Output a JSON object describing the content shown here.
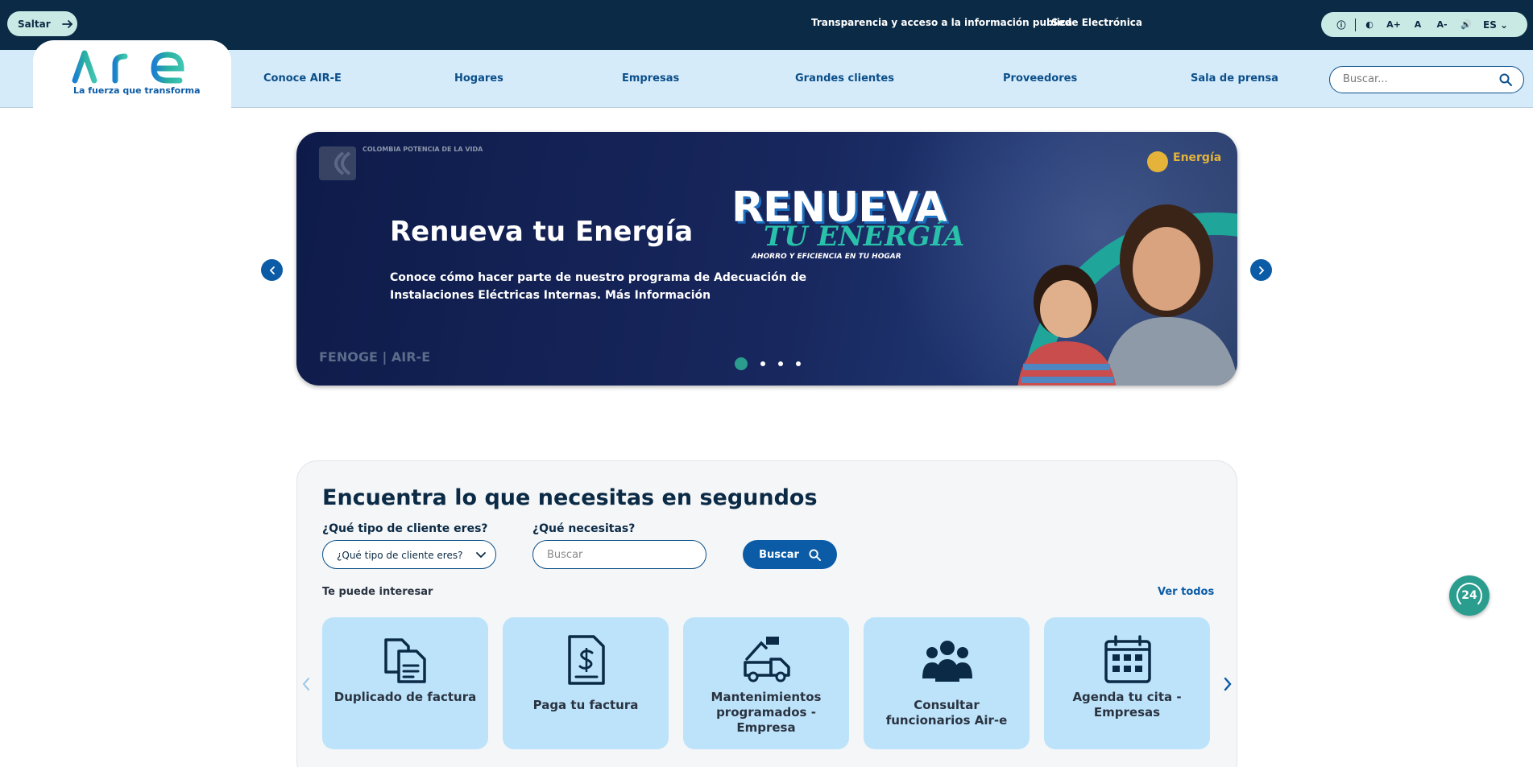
{
  "topbar": {
    "skip_label": "Saltar",
    "links": [
      "Transparencia y acceso a la información publica",
      "Sede Electrónica"
    ],
    "a11y_buttons": [
      "ⓘ",
      "◐",
      "A+",
      "A",
      "A-",
      "🔊"
    ],
    "language": "ES"
  },
  "brand": {
    "wordmark": "AIR-E",
    "tagline": "La fuerza que transforma",
    "color_primary": "#0b5ba6",
    "color_teal": "#2a9d8f",
    "color_dark": "#0b2a45"
  },
  "nav": {
    "items": [
      "Conoce AIR-E",
      "Hogares",
      "Empresas",
      "Grandes clientes",
      "Proveedores",
      "Sala de prensa"
    ],
    "search_placeholder": "Buscar..."
  },
  "hero": {
    "title": "Renueva tu Energía",
    "description": "Conoce cómo hacer parte de nuestro programa de Adecuación de Instalaciones Eléctricas Internas. Más Información",
    "logo_colombia": "COLOMBIA POTENCIA DE LA VIDA",
    "logo_energia": "Energía",
    "campaign_word": "RENUEVA",
    "campaign_sub": "TU ENERGÍA",
    "campaign_tag": "AHORRO Y EFICIENCIA EN TU HOGAR",
    "footer_logos": "FENOGE | AIR-E",
    "slide_count": 4,
    "active_slide": 1
  },
  "finder": {
    "title": "Encuentra lo que necesitas en segundos",
    "client_type_label": "¿Qué tipo de cliente eres?",
    "client_type_value": "¿Qué tipo de cliente eres?",
    "need_label": "¿Qué necesitas?",
    "need_placeholder": "Buscar",
    "search_button": "Buscar",
    "interest_label": "Te puede interesar",
    "see_all": "Ver todos",
    "cards": [
      {
        "label": "Duplicado de factura",
        "icon": "documents-icon"
      },
      {
        "label": "Paga tu factura",
        "icon": "bill-dollar-icon"
      },
      {
        "label": "Mantenimientos programados - Empresa",
        "icon": "utility-truck-icon"
      },
      {
        "label": "Consultar funcionarios Air-e",
        "icon": "people-group-icon"
      },
      {
        "label": "Agenda tu cita - Empresas",
        "icon": "calendar-icon"
      }
    ]
  },
  "support": {
    "label": "24"
  }
}
